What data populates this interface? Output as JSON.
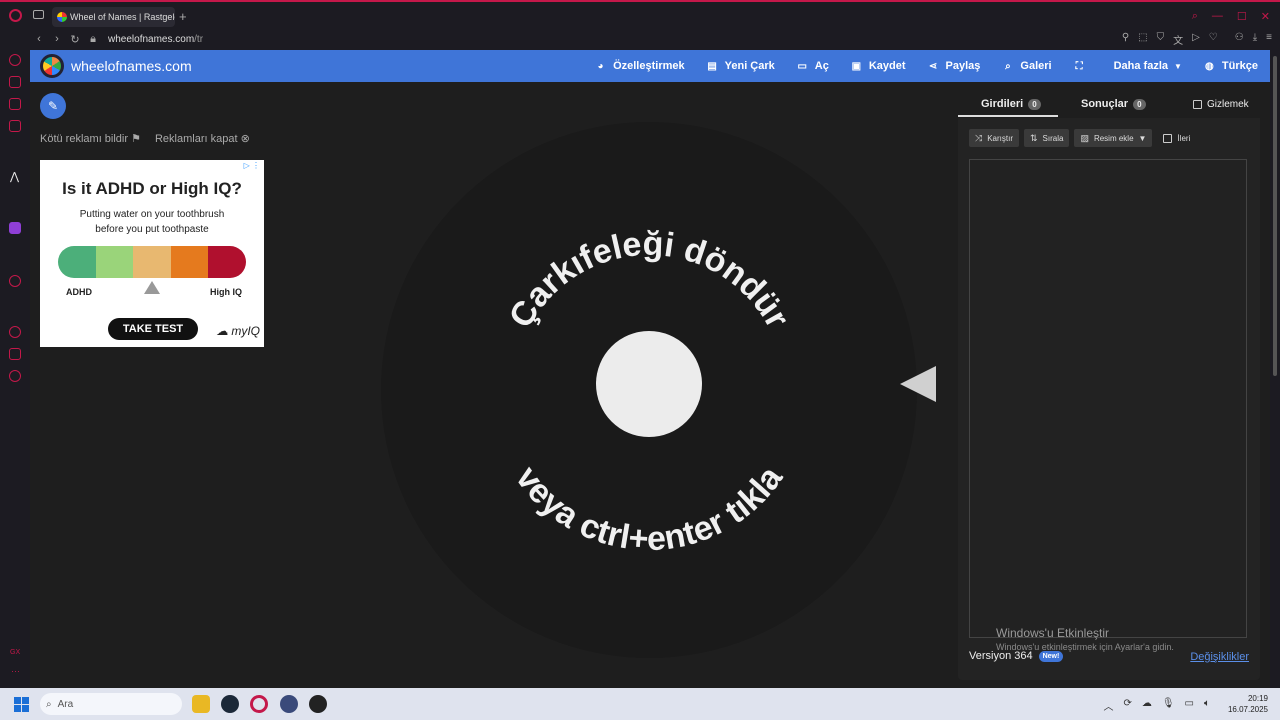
{
  "browser": {
    "tab_title": "Wheel of Names | Rastgele",
    "url_host": "wheelofnames.com",
    "url_path": "/tr"
  },
  "header": {
    "brand": "wheelofnames.com",
    "menu": [
      {
        "label": "Özelleştirmek",
        "icon": "palette-icon"
      },
      {
        "label": "Yeni Çark",
        "icon": "new-file-icon"
      },
      {
        "label": "Aç",
        "icon": "folder-icon"
      },
      {
        "label": "Kaydet",
        "icon": "save-icon"
      },
      {
        "label": "Paylaş",
        "icon": "share-icon"
      },
      {
        "label": "Galeri",
        "icon": "search-icon"
      },
      {
        "label": "",
        "icon": "fullscreen-icon"
      },
      {
        "label": "Daha fazla",
        "icon": "chevron-down-icon"
      },
      {
        "label": "Türkçe",
        "icon": "globe-icon"
      }
    ]
  },
  "ads": {
    "report": "Kötü reklamı bildir",
    "close": "Reklamları kapat",
    "headline": "Is it ADHD or High IQ?",
    "body1": "Putting water on your toothbrush",
    "body2": "before you put toothpaste",
    "left_label": "ADHD",
    "right_label": "High IQ",
    "cta": "TAKE TEST",
    "brand": "myIQ",
    "colors": [
      "#4caf7a",
      "#9ad47a",
      "#e8b870",
      "#e57a1e",
      "#b0102e"
    ]
  },
  "wheel": {
    "top_text": "Çarkıfeleği döndür",
    "bottom_text": "veya ctrl+enter tıkla"
  },
  "panel": {
    "tab_entries": "Girdileri",
    "entries_count": "0",
    "tab_results": "Sonuçlar",
    "results_count": "0",
    "hide_label": "Gizlemek",
    "shuffle": "Karıştır",
    "sort": "Sırala",
    "add_image": "Resim ekle",
    "advanced": "İleri",
    "version": "Versiyon 364",
    "new_badge": "New!",
    "changes": "Değişiklikler"
  },
  "watermark": {
    "line1": "Windows'u Etkinleştir",
    "line2": "Windows'u etkinleştirmek için Ayarlar'a gidin."
  },
  "taskbar": {
    "search": "Ara",
    "time": "20:19",
    "date": "16.07.2025"
  }
}
